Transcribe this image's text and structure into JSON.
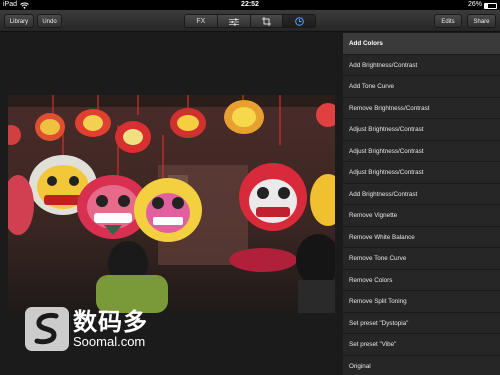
{
  "status_bar": {
    "carrier": "iPad",
    "time": "22:52",
    "battery": "26%"
  },
  "toolbar": {
    "library_label": "Library",
    "undo_label": "Undo",
    "fx_label": "FX",
    "edits_label": "Edits",
    "share_label": "Share",
    "segment_icons": [
      "adjust-sliders-icon",
      "crop-icon",
      "history-clock-icon"
    ]
  },
  "history": {
    "items": [
      "Add Colors",
      "Add Brightness/Contrast",
      "Add Tone Curve",
      "Remove Brightness/Contrast",
      "Adjust Brightness/Contrast",
      "Adjust Brightness/Contrast",
      "Adjust Brightness/Contrast",
      "Add Brightness/Contrast",
      "Remove Vignette",
      "Remove White Balance",
      "Remove Tone Curve",
      "Remove Colors",
      "Remove Split Toning",
      "Set preset \"Dystopia\"",
      "Set preset \"Vibe\"",
      "Original"
    ],
    "selected_index": 0
  },
  "watermark": {
    "cn": "数码多",
    "en": "Soomal.com"
  }
}
